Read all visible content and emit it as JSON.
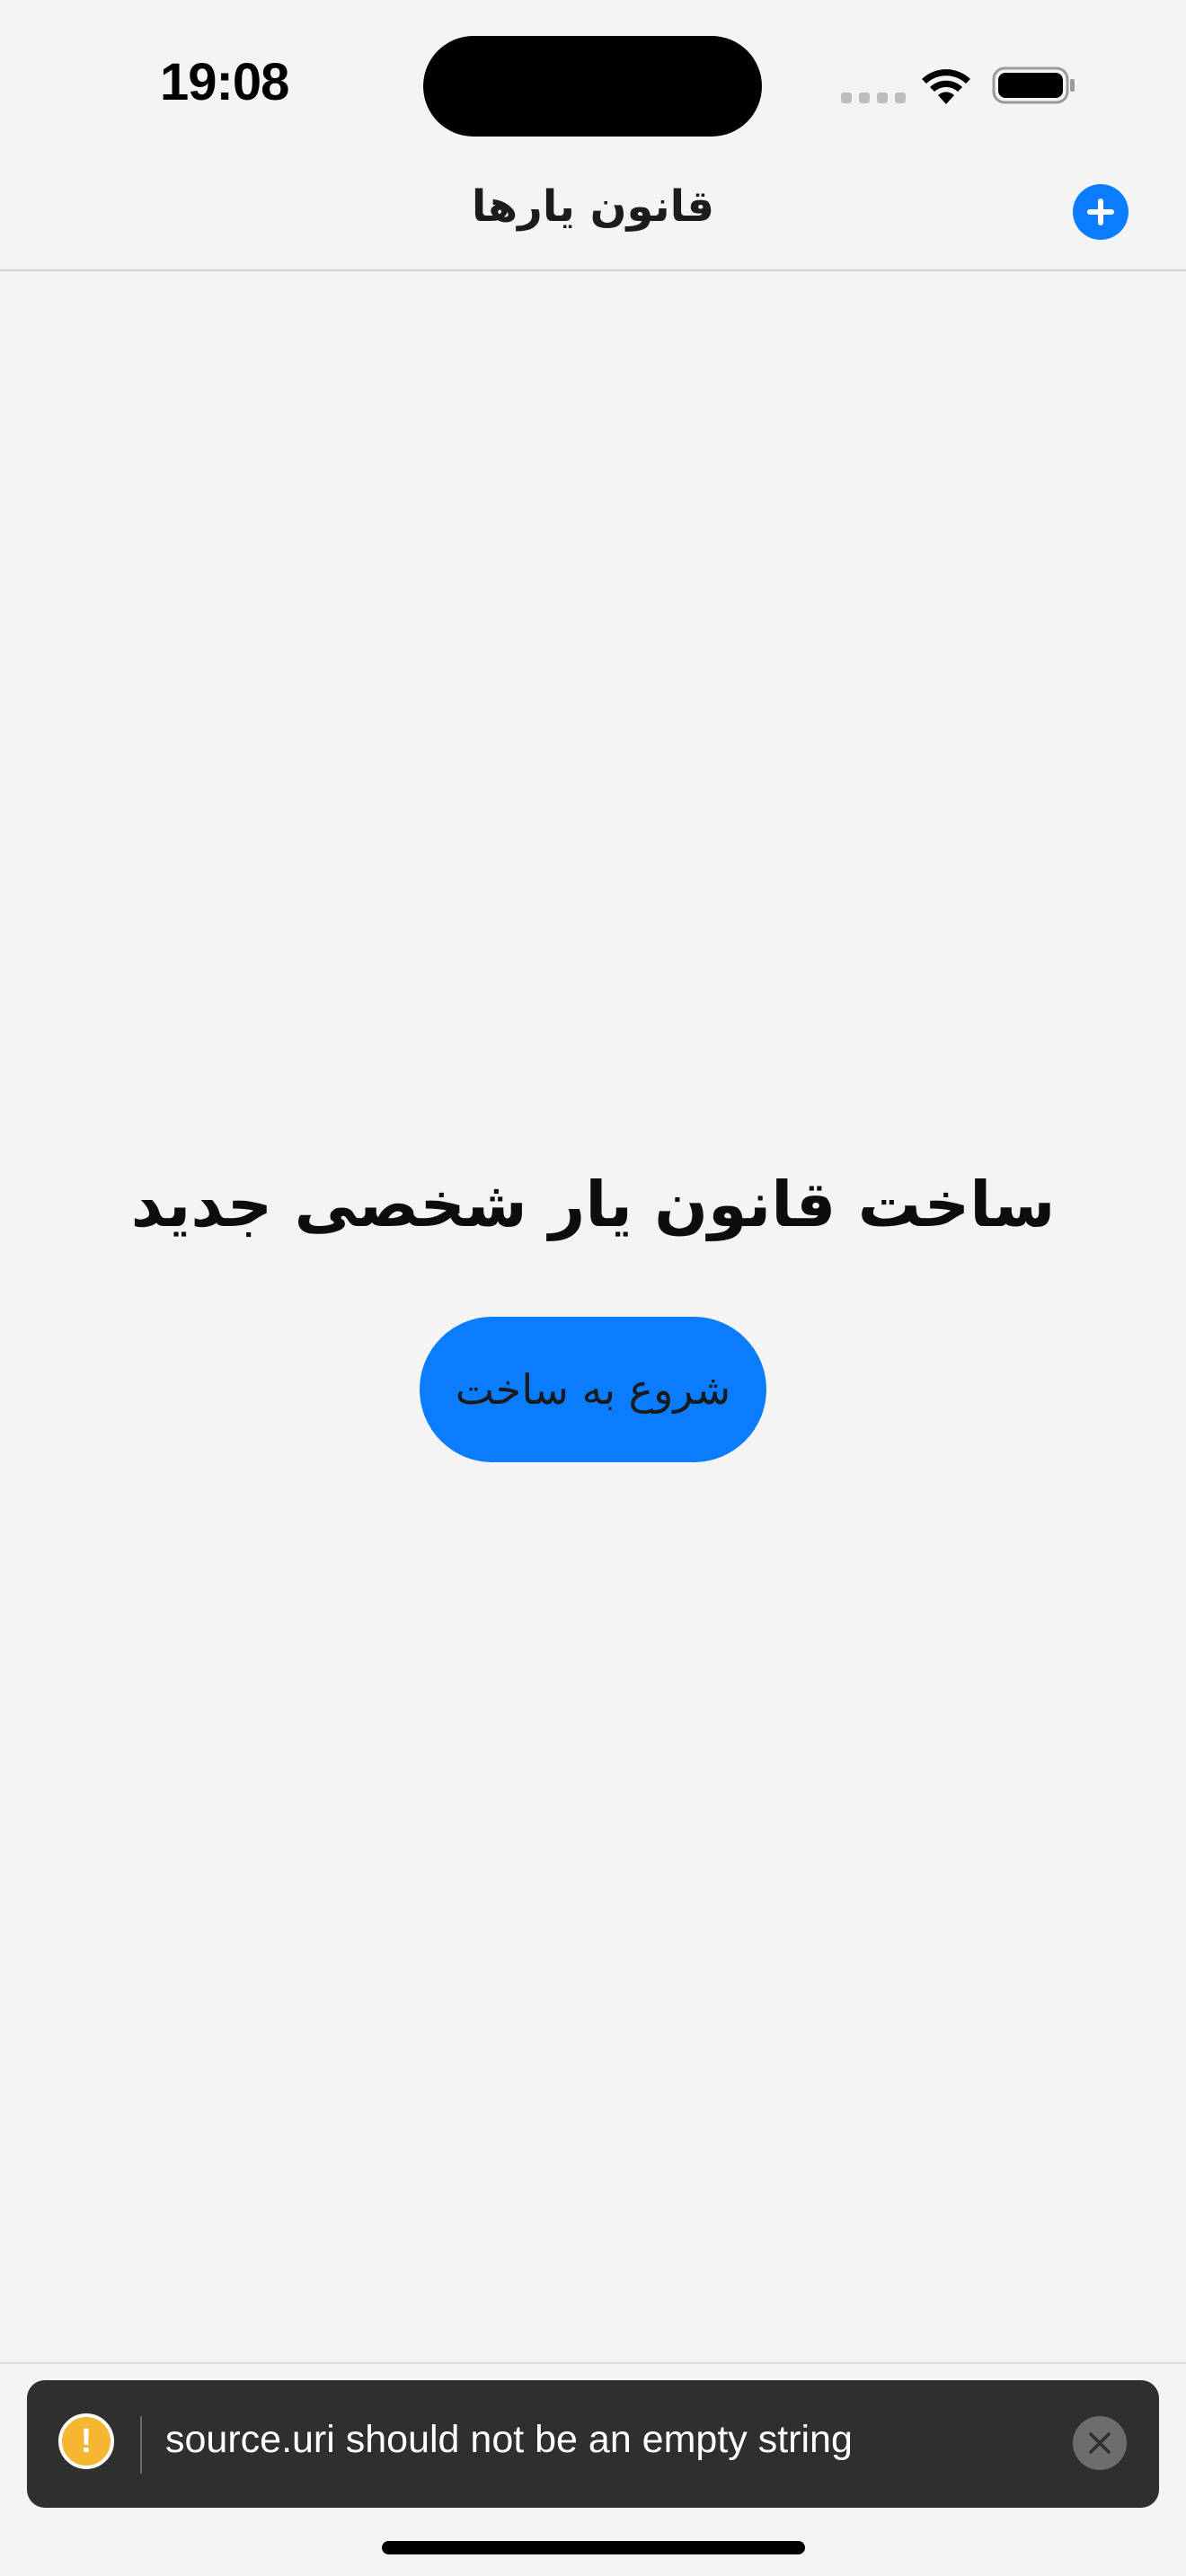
{
  "status_bar": {
    "time": "19:08",
    "icons": [
      "signal-dots-icon",
      "wifi-icon",
      "battery-icon"
    ]
  },
  "header": {
    "title": "قانون یارها",
    "add_icon": "plus-circle-icon",
    "accent_color": "#0a7cff"
  },
  "main": {
    "empty_title": "ساخت قانون یار شخصی جدید",
    "start_button_label": "شروع به ساخت"
  },
  "toast": {
    "icon": "warning-icon",
    "warning_glyph": "!",
    "message": "source.uri should not be an empty string",
    "close_icon": "close-icon"
  }
}
